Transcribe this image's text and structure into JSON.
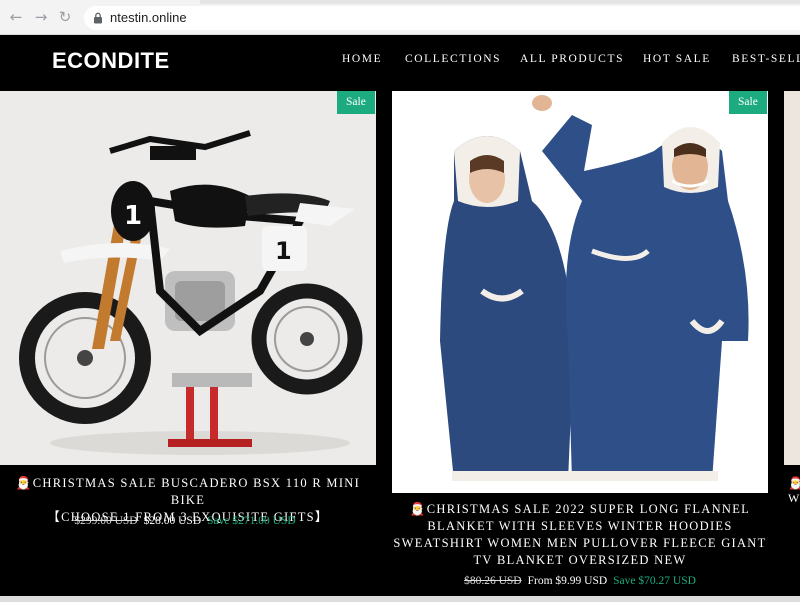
{
  "browser": {
    "url": "ntestin.online"
  },
  "header": {
    "logo": "ECONDITE",
    "nav": [
      "HOME",
      "COLLECTIONS",
      "ALL PRODUCTS",
      "HOT SALE",
      "BEST-SELL"
    ]
  },
  "products": [
    {
      "badge": "Sale",
      "title_line1": "🎅CHRISTMAS SALE BUSCADERO BSX 110 R MINI BIKE",
      "title_line2": "【CHOOSE 1 FROM 3 EXQUISITE GIFTS】",
      "old_price": "$299.00 USD",
      "price": "$28.00 USD",
      "save": "Save $271.00 USD"
    },
    {
      "badge": "Sale",
      "title_line1": "🎅CHRISTMAS SALE 2022 SUPER LONG FLANNEL",
      "title_line2": "BLANKET WITH SLEEVES WINTER HOODIES",
      "title_line3": "SWEATSHIRT WOMEN MEN PULLOVER FLEECE GIANT",
      "title_line4": "TV BLANKET OVERSIZED NEW",
      "old_price": "$80.26 USD",
      "price": "From $9.99 USD",
      "save": "Save $70.27 USD"
    }
  ],
  "partial_card": {
    "title_fragment": "W"
  },
  "colors": {
    "accent": "#1cab7f",
    "background": "#000000"
  }
}
